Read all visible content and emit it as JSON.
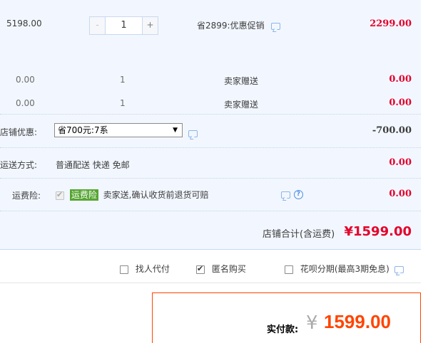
{
  "item_main": {
    "unit_price": "5198.00",
    "qty_minus": "-",
    "qty_value": "1",
    "qty_plus": "+",
    "promotion": "省2899:优惠促销",
    "subtotal": "2299.00"
  },
  "gifts": [
    {
      "price": "0.00",
      "qty": "1",
      "label": "卖家赠送",
      "subtotal": "0.00"
    },
    {
      "price": "0.00",
      "qty": "1",
      "label": "卖家赠送",
      "subtotal": "0.00"
    }
  ],
  "shop_discount": {
    "label": "店铺优惠:",
    "selected": "省700元:7系",
    "arrow": "▼",
    "amount": "-700.00"
  },
  "shipping": {
    "label": "运送方式:",
    "value": "普通配送 快递 免邮",
    "amount": "0.00"
  },
  "insurance": {
    "label": "运费险:",
    "tag": "运费险",
    "desc": "卖家送,确认收货前退货可赔",
    "help": "?",
    "amount": "0.00"
  },
  "shop_total": {
    "label": "店铺合计(含运费)",
    "amount": "¥1599.00"
  },
  "options": {
    "proxy_pay": "找人代付",
    "anonymous": "匿名购买",
    "installment": "花呗分期(最高3期免息)"
  },
  "payment": {
    "label": "实付款:",
    "currency": "¥",
    "amount": "1599.00"
  },
  "colors": {
    "accent_red": "#f40",
    "section_bg": "#f2f7ff",
    "insurance_green": "#55a532"
  }
}
